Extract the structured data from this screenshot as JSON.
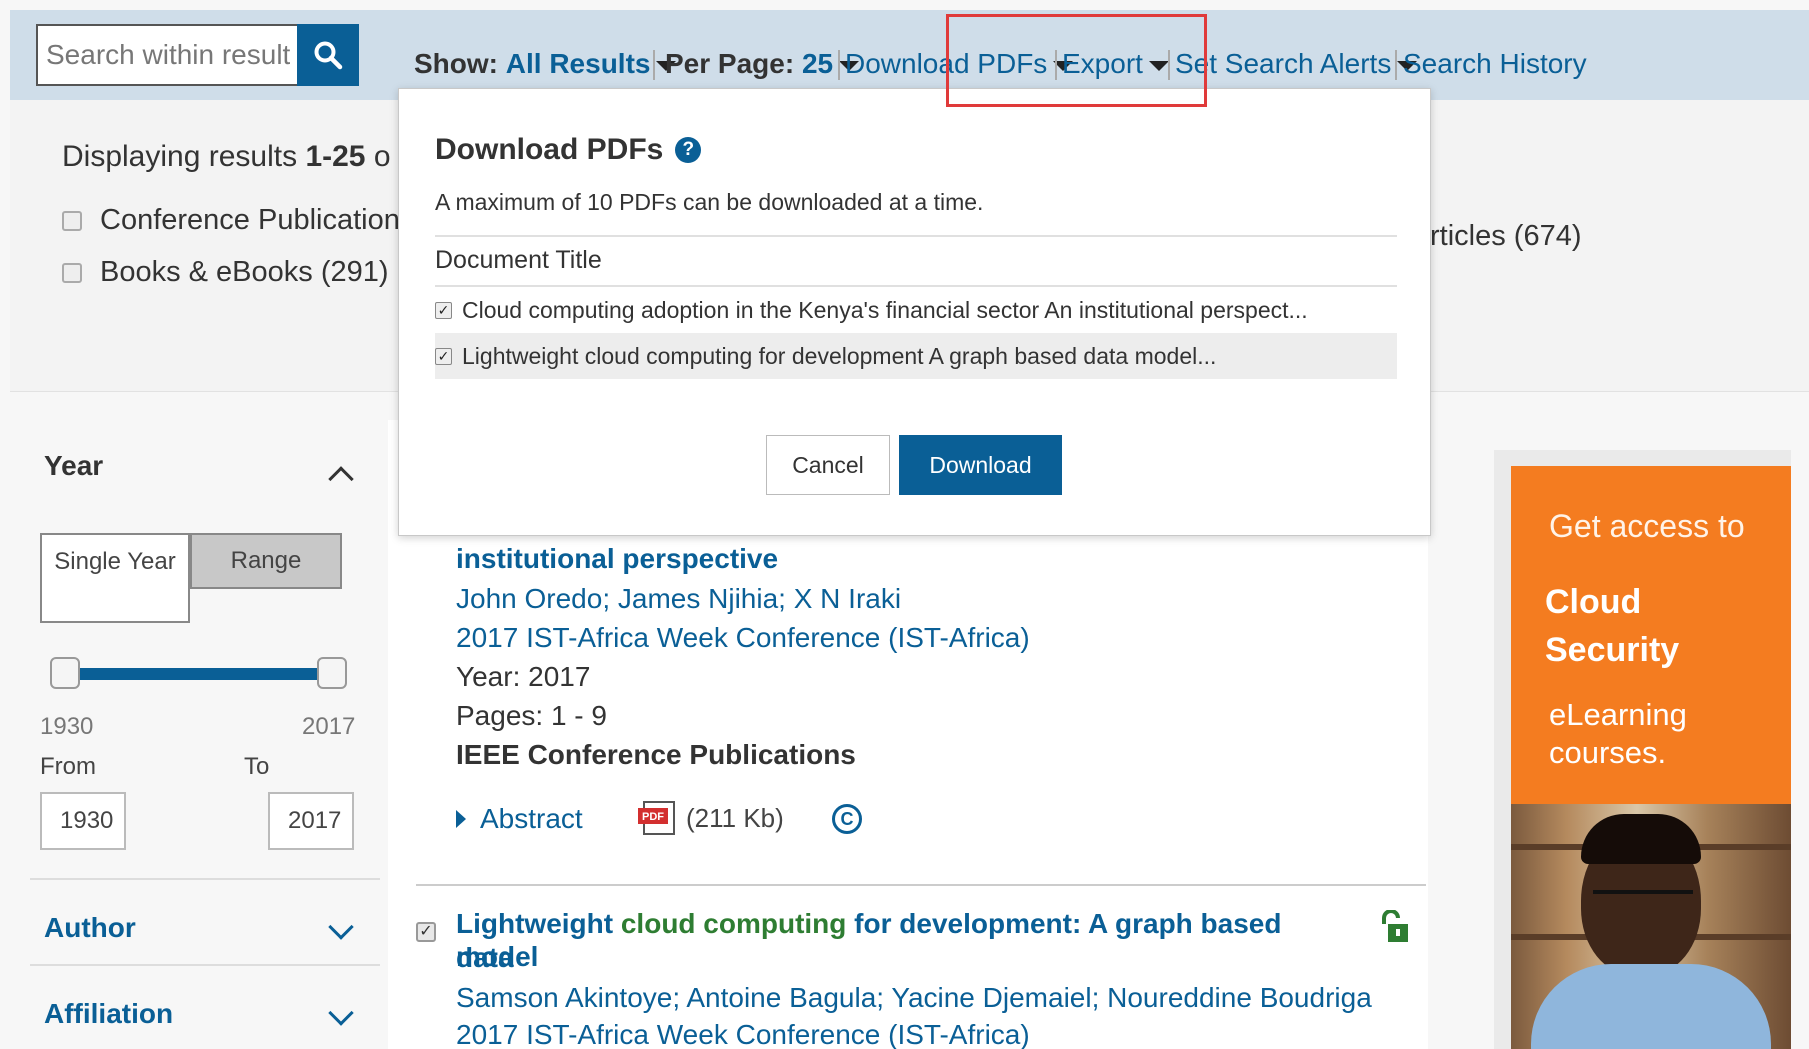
{
  "toolbar": {
    "search_placeholder": "Search within results",
    "show_label": "Show:",
    "show_value": "All Results",
    "per_page_label": "Per Page:",
    "per_page_value": "25",
    "download_pdfs": "Download PDFs",
    "export": "Export",
    "set_search_alerts": "Set Search Alerts",
    "search_history": "Search History"
  },
  "results_header": {
    "displaying_prefix": "Displaying results ",
    "displaying_range": "1-25",
    "displaying_tail": " o",
    "facets": [
      {
        "label": "Conference Publications"
      },
      {
        "label": "Books & eBooks (291)"
      }
    ],
    "journals_tail": "rticles (674)"
  },
  "sidebar": {
    "year_title": "Year",
    "single_year": "Single Year",
    "range": "Range",
    "range_min": "1930",
    "range_max": "2017",
    "from_label": "From",
    "to_label": "To",
    "from_value": "1930",
    "to_value": "2017",
    "author_title": "Author",
    "affiliation_title": "Affiliation"
  },
  "results": [
    {
      "title_tail": "institutional perspective",
      "authors": "John Oredo; James Njihia; X N Iraki",
      "venue": "2017 IST-Africa Week Conference (IST-Africa)",
      "year": "Year: 2017",
      "pages": "Pages: 1 - 9",
      "publisher": "IEEE Conference Publications",
      "abstract": "Abstract",
      "pdf_size": "(211 Kb)",
      "copyright": "C"
    },
    {
      "title_pre": "Lightweight ",
      "title_highlight": "cloud computing",
      "title_post": " for development: A graph based data",
      "title_line2": "model",
      "authors": "Samson Akintoye; Antoine Bagula; Yacine Djemaiel; Noureddine Boudriga",
      "venue": "2017 IST-Africa Week Conference (IST-Africa)"
    }
  ],
  "ad": {
    "line1": "Get access to",
    "line2": "Cloud",
    "line3": "Security",
    "line4": "eLearning",
    "line5": "courses."
  },
  "popup": {
    "title": "Download PDFs",
    "help": "?",
    "subtitle": "A maximum of 10 PDFs can be downloaded at a time.",
    "column_header": "Document Title",
    "documents": [
      {
        "title": "Cloud computing adoption in the Kenya's financial sector An institutional perspect..."
      },
      {
        "title": "Lightweight cloud computing for development A graph based data model..."
      }
    ],
    "cancel": "Cancel",
    "download": "Download"
  },
  "colors": {
    "brand_blue": "#0a5f96",
    "toolbar_bg": "#cfdde9",
    "highlight_red": "#e03a3a",
    "ad_orange": "#f47c20",
    "title_green": "#2e7d32"
  }
}
